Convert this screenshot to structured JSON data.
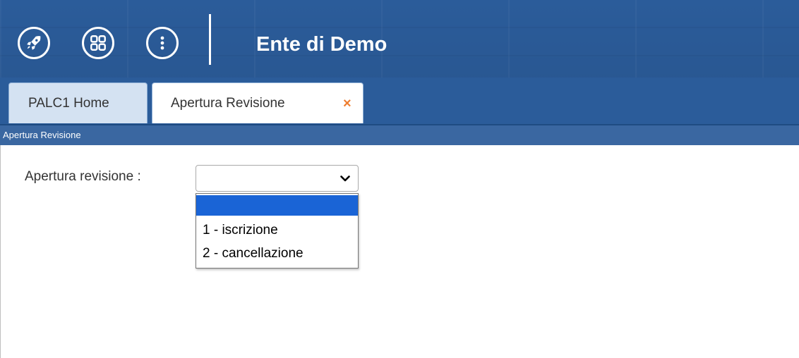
{
  "header": {
    "title": "Ente di Demo",
    "icons": [
      "rocket-icon",
      "apps-grid-icon",
      "more-vertical-icon"
    ],
    "background_color": "#2b5c9a"
  },
  "tabs": [
    {
      "label": "PALC1 Home",
      "active": false
    },
    {
      "label": "Apertura Revisione",
      "active": true,
      "close_label": "×"
    }
  ],
  "breadcrumb": "Apertura Revisione",
  "form": {
    "label": "Apertura revisione :",
    "select": {
      "selected_value": "",
      "options": [
        "",
        "1 - iscrizione",
        "2 - cancellazione"
      ]
    }
  },
  "colors": {
    "accent": "#ee7d2f",
    "option_highlight": "#1a64d6"
  }
}
